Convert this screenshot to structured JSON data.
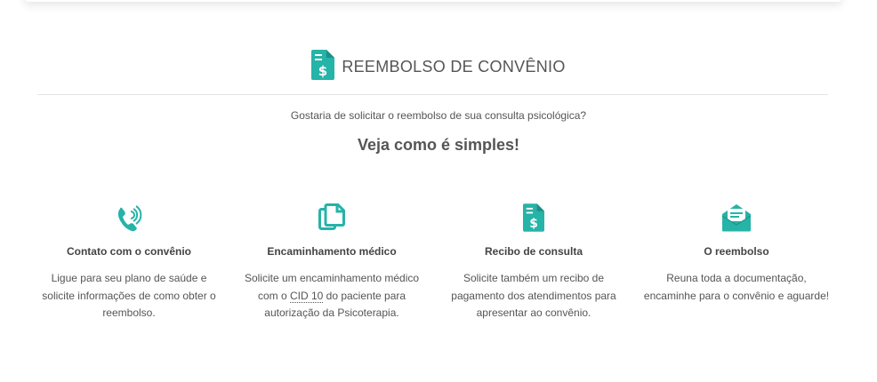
{
  "colors": {
    "accent": "#26b3a8",
    "text": "#555555",
    "divider": "#e4e4e4"
  },
  "section": {
    "icon": "receipt-dollar-icon",
    "title": "REEMBOLSO DE CONVÊNIO",
    "question": "Gostaria de solicitar o reembolso de sua consulta psicológica?",
    "subtitle": "Veja como é simples!"
  },
  "steps": [
    {
      "icon": "phone-call-icon",
      "title": "Contato com o convênio",
      "text": "Ligue para seu plano de saúde e solicite informações de como obter o reembolso."
    },
    {
      "icon": "documents-copy-icon",
      "title": "Encaminhamento médico",
      "text_before": "Solicite um encaminhamento médico com o ",
      "abbr": "CID 10",
      "text_after": " do paciente para autorização da Psicoterapia."
    },
    {
      "icon": "receipt-dollar-icon",
      "title": "Recibo de consulta",
      "text": "Solicite também um recibo de pagamento dos atendimentos para apresentar ao convênio."
    },
    {
      "icon": "envelope-open-icon",
      "title": "O reembolso",
      "text": "Reuna toda a documentação, encaminhe para o convênio e aguarde!"
    }
  ]
}
